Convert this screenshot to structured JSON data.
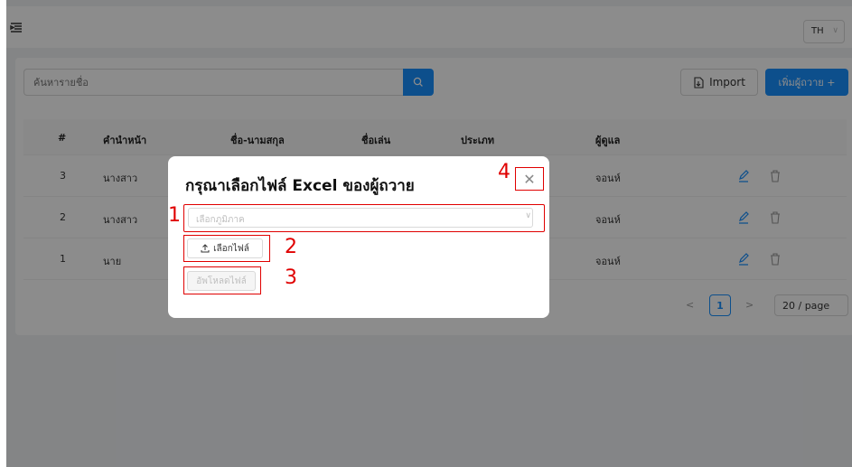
{
  "topbar": {
    "language": "TH"
  },
  "toolbar": {
    "search_placeholder": "ค้นหารายชื่อ",
    "import_label": "Import",
    "add_label": "เพิ่มผู้ถวาย +"
  },
  "table": {
    "columns": [
      "#",
      "คำนำหน้า",
      "ชื่อ-นามสกุล",
      "ชื่อเล่น",
      "ประเภท",
      "ผู้ดูแล"
    ],
    "rows": [
      {
        "no": "3",
        "prefix": "นางสาว",
        "caretaker": "จอนห์"
      },
      {
        "no": "2",
        "prefix": "นางสาว",
        "caretaker": "จอนห์"
      },
      {
        "no": "1",
        "prefix": "นาย",
        "caretaker": "จอนห์"
      }
    ]
  },
  "pagination": {
    "prev": "<",
    "current": "1",
    "next": ">",
    "page_size": "20 / page"
  },
  "modal": {
    "title": "กรุณาเลือกไฟล์ Excel ของผู้ถวาย",
    "region_placeholder": "เลือกภูมิภาค",
    "choose_file_label": "เลือกไฟล์",
    "upload_label": "อัพโหลดไฟล์",
    "close": "✕"
  },
  "annotations": {
    "a1": "1",
    "a2": "2",
    "a3": "3",
    "a4": "4"
  },
  "icons": {
    "menu": "menu-fold-icon",
    "search": "search-icon",
    "import": "file-import-icon",
    "edit": "edit-icon",
    "delete": "delete-icon",
    "upload": "upload-icon",
    "chevron": "chevron-down-icon"
  },
  "colors": {
    "primary": "#1890ff",
    "annotation": "#e00000",
    "mask": "rgba(0,0,0,0.45)"
  }
}
